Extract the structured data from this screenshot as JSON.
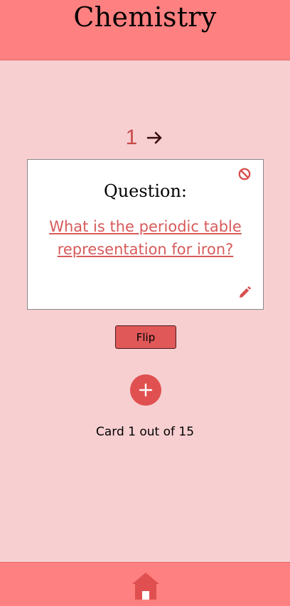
{
  "header": {
    "title": "Chemistry"
  },
  "navigation": {
    "card_number": "1",
    "next_icon": "arrow-right-icon"
  },
  "card": {
    "heading": "Question:",
    "text": "What is the periodic table representation for iron?",
    "block_icon": "block-icon",
    "edit_icon": "pencil-icon"
  },
  "controls": {
    "flip_label": "Flip",
    "add_icon": "plus-icon"
  },
  "status": {
    "card_count": "Card 1 out of 15"
  },
  "footer": {
    "home_icon": "home-icon"
  },
  "colors": {
    "header_bg": "#ff8080",
    "page_bg": "#f7cfd0",
    "accent": "#e05858",
    "accent_text": "#d85a5a"
  }
}
